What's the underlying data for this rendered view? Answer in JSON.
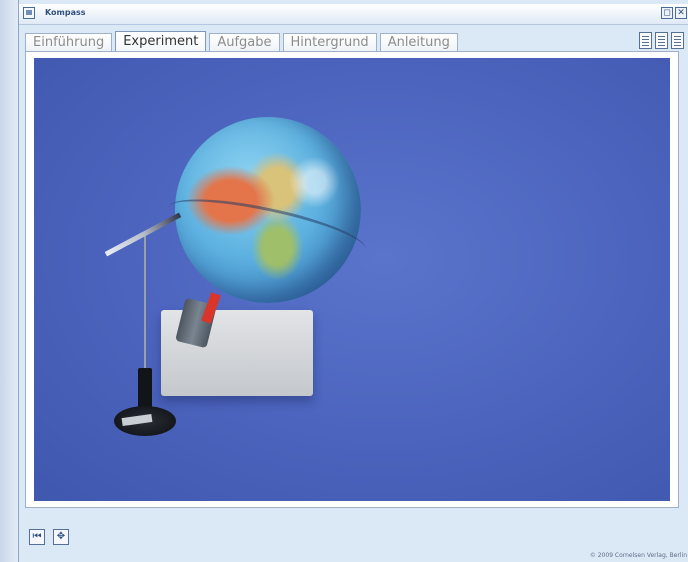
{
  "window": {
    "title": "Kompass",
    "controls": {
      "restore": "◻",
      "close": "✕"
    }
  },
  "tabs": [
    {
      "label": "Einführung",
      "active": false
    },
    {
      "label": "Experiment",
      "active": true
    },
    {
      "label": "Aufgabe",
      "active": false
    },
    {
      "label": "Hintergrund",
      "active": false
    },
    {
      "label": "Anleitung",
      "active": false
    }
  ],
  "view_icons": [
    "page-view-icon",
    "print-view-icon",
    "document-view-icon"
  ],
  "content": {
    "image_subject": "globe-with-compass-needle-photo"
  },
  "bottom": {
    "buttons": [
      {
        "name": "skip-back-button",
        "icon": "⏮"
      },
      {
        "name": "navigate-button",
        "icon": "✥"
      }
    ],
    "copyright": "© 2009 Cornelsen Verlag, Berlin"
  },
  "colors": {
    "window_bg": "#dbe8f5",
    "title_text": "#2f4f7f",
    "photo_bg": "#4b63bc"
  }
}
